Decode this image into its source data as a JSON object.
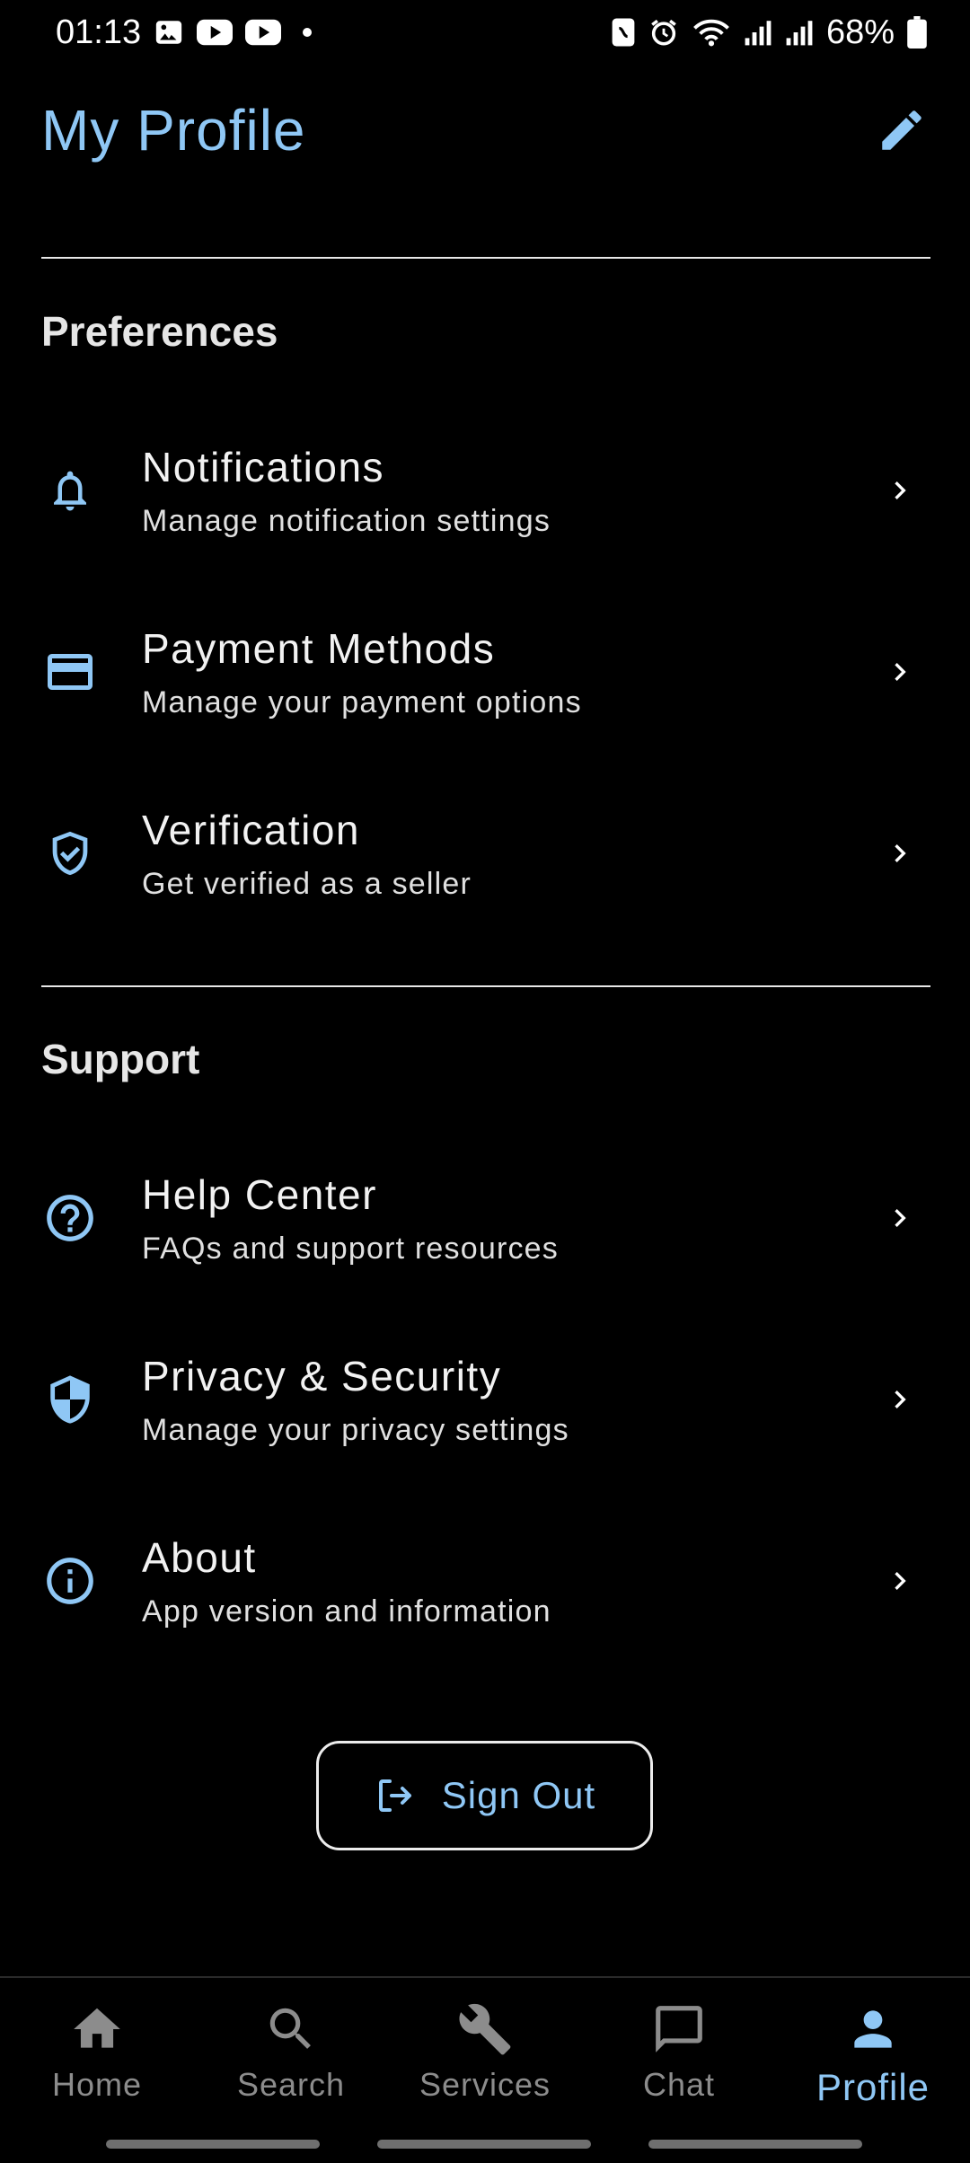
{
  "status_bar": {
    "time": "01:13",
    "battery": "68%",
    "left_icons": [
      "gallery-icon",
      "youtube-icon",
      "youtube-icon"
    ],
    "right_icons": [
      "nfc-icon",
      "alarm-icon",
      "wifi-icon",
      "signal-icon",
      "signal-icon",
      "battery-icon"
    ]
  },
  "header": {
    "title": "My Profile",
    "edit_icon": "pencil-icon"
  },
  "sections": {
    "preferences": {
      "title": "Preferences",
      "items": [
        {
          "title": "Notifications",
          "subtitle": "Manage notification settings",
          "icon": "bell-icon"
        },
        {
          "title": "Payment Methods",
          "subtitle": "Manage your payment options",
          "icon": "credit-card-icon"
        },
        {
          "title": "Verification",
          "subtitle": "Get verified as a seller",
          "icon": "shield-check-icon"
        }
      ]
    },
    "support": {
      "title": "Support",
      "items": [
        {
          "title": "Help Center",
          "subtitle": "FAQs and support resources",
          "icon": "help-circle-icon"
        },
        {
          "title": "Privacy & Security",
          "subtitle": "Manage your privacy settings",
          "icon": "shield-icon"
        },
        {
          "title": "About",
          "subtitle": "App version and information",
          "icon": "info-icon"
        }
      ]
    }
  },
  "sign_out": {
    "label": "Sign Out",
    "icon": "logout-icon"
  },
  "bottom_nav": {
    "items": [
      {
        "label": "Home",
        "icon": "home-icon"
      },
      {
        "label": "Search",
        "icon": "search-icon"
      },
      {
        "label": "Services",
        "icon": "wrench-icon"
      },
      {
        "label": "Chat",
        "icon": "chat-icon"
      },
      {
        "label": "Profile",
        "icon": "person-icon"
      }
    ],
    "active": "Profile"
  },
  "colors": {
    "accent": "#8fc7f5",
    "background": "#000000",
    "text": "#f2f2f2",
    "inactive": "#8c8c8c"
  }
}
